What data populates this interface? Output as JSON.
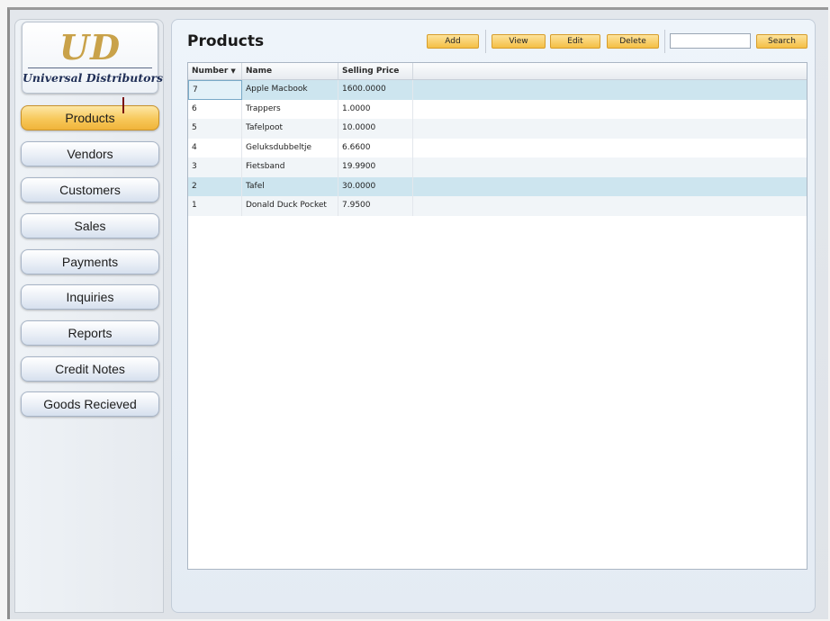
{
  "logo": {
    "mark": "UD",
    "name": "Universal Distributors"
  },
  "nav": {
    "items": [
      {
        "label": "Products",
        "active": true
      },
      {
        "label": "Vendors"
      },
      {
        "label": "Customers"
      },
      {
        "label": "Sales"
      },
      {
        "label": "Payments"
      },
      {
        "label": "Inquiries"
      },
      {
        "label": "Reports"
      },
      {
        "label": "Credit Notes"
      },
      {
        "label": "Goods Recieved"
      }
    ]
  },
  "main": {
    "title": "Products",
    "toolbar": {
      "add_label": "Add",
      "view_label": "View",
      "edit_label": "Edit",
      "delete_label": "Delete",
      "search_value": "",
      "search_label": "Search"
    },
    "table": {
      "columns": [
        "Number",
        "Name",
        "Selling Price"
      ],
      "sort_column": "Number",
      "rows": [
        {
          "number": "7",
          "name": "Apple Macbook",
          "price": "1600.0000"
        },
        {
          "number": "6",
          "name": "Trappers",
          "price": "1.0000"
        },
        {
          "number": "5",
          "name": "Tafelpoot",
          "price": "10.0000"
        },
        {
          "number": "4",
          "name": "Geluksdubbeltje",
          "price": "6.6600"
        },
        {
          "number": "3",
          "name": "Fietsband",
          "price": "19.9900"
        },
        {
          "number": "2",
          "name": "Tafel",
          "price": "30.0000"
        },
        {
          "number": "1",
          "name": "Donald Duck Pocket",
          "price": "7.9500"
        }
      ]
    }
  },
  "colors": {
    "accent": "#f4bf45",
    "selected_row": "#cde5ef",
    "logo_gold": "#c9a24a",
    "logo_navy": "#1f2e56"
  }
}
